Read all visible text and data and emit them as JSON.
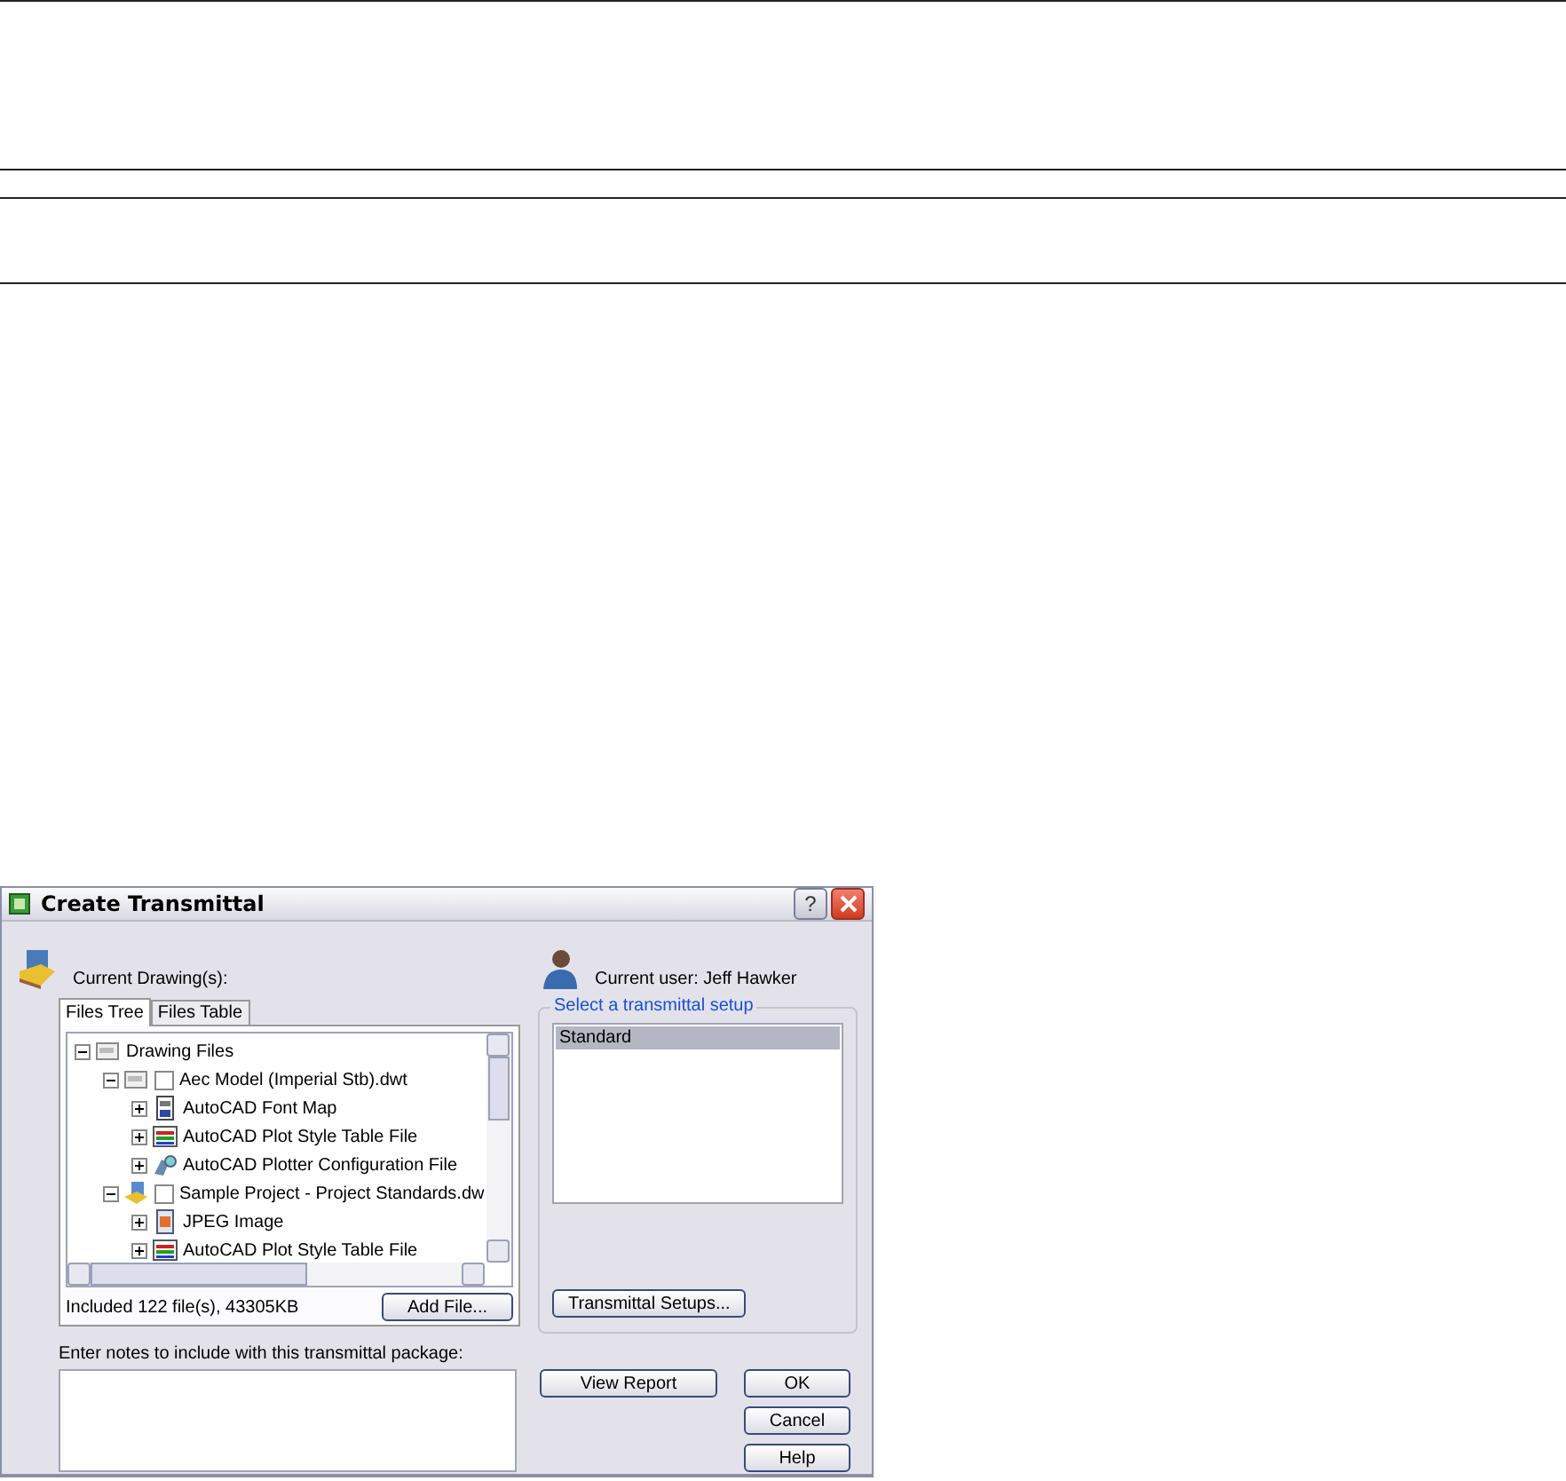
{
  "dialog": {
    "title": "Create Transmittal",
    "help_glyph": "?"
  },
  "drawing_label": "Current Drawing(s):",
  "user_label": "Current user: Jeff Hawker",
  "tabs": [
    {
      "label": "Files Tree",
      "selected": true
    },
    {
      "label": "Files Table",
      "selected": false
    }
  ],
  "tree": [
    {
      "kind": "dwg",
      "label": "Drawing Files",
      "expanded": true,
      "children": [
        {
          "kind": "dwt",
          "label": "Aec Model (Imperial Stb).dwt",
          "expanded": true,
          "checked": false,
          "children": [
            {
              "kind": "font",
              "label": "AutoCAD Font Map",
              "expanded": false
            },
            {
              "kind": "plotstyle",
              "label": "AutoCAD Plot Style Table File",
              "expanded": false
            },
            {
              "kind": "plotter",
              "label": "AutoCAD Plotter Configuration File",
              "expanded": false
            }
          ]
        },
        {
          "kind": "project",
          "label": "Sample Project - Project Standards.dw",
          "expanded": true,
          "checked": false,
          "children": [
            {
              "kind": "jpeg",
              "label": "JPEG Image",
              "expanded": false
            },
            {
              "kind": "plotstyle",
              "label": "AutoCAD Plot Style Table File",
              "expanded": false
            }
          ]
        }
      ]
    }
  ],
  "summary": "Included 122 file(s), 43305KB",
  "add_file_button": "Add File...",
  "notes_label": "Enter notes to include with this transmittal package:",
  "setup_group": {
    "legend": "Select a transmittal setup",
    "items": [
      {
        "label": "Standard",
        "selected": true
      }
    ],
    "button": "Transmittal Setups..."
  },
  "view_report_button": "View Report",
  "buttons": [
    "OK",
    "Cancel",
    "Help"
  ]
}
